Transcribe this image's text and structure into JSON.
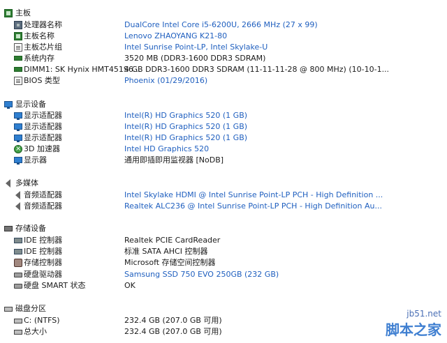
{
  "sections": {
    "motherboard": {
      "title": "主板",
      "items": [
        {
          "label": "处理器名称",
          "value": "DualCore Intel Core i5-6200U, 2666 MHz (27 x 99)",
          "icon": "cpu-icon"
        },
        {
          "label": "主板名称",
          "value": "Lenovo ZHAOYANG K21-80",
          "icon": "motherboard-icon"
        },
        {
          "label": "主板芯片组",
          "value": "Intel Sunrise Point-LP, Intel Skylake-U",
          "icon": "chipset-icon"
        },
        {
          "label": "系统内存",
          "value": "3520 MB  (DDR3-1600 DDR3 SDRAM)",
          "icon": "memory-icon"
        },
        {
          "label": "DIMM1: SK Hynix HMT451S6...",
          "value": "4 GB DDR3-1600 DDR3 SDRAM  (11-11-11-28 @ 800 MHz)  (10-10-1...",
          "icon": "memory-icon"
        },
        {
          "label": "BIOS 类型",
          "value": "Phoenix (01/29/2016)",
          "icon": "bios-icon"
        }
      ]
    },
    "display": {
      "title": "显示设备",
      "items": [
        {
          "label": "显示适配器",
          "value": "Intel(R) HD Graphics 520  (1 GB)",
          "icon": "display-adapter-icon"
        },
        {
          "label": "显示适配器",
          "value": "Intel(R) HD Graphics 520  (1 GB)",
          "icon": "display-adapter-icon"
        },
        {
          "label": "显示适配器",
          "value": "Intel(R) HD Graphics 520  (1 GB)",
          "icon": "display-adapter-icon"
        },
        {
          "label": "3D 加速器",
          "value": "Intel HD Graphics 520",
          "icon": "3d-accelerator-icon"
        },
        {
          "label": "显示器",
          "value": "通用即插即用监视器 [NoDB]",
          "icon": "monitor-icon"
        }
      ]
    },
    "multimedia": {
      "title": "多媒体",
      "items": [
        {
          "label": "音频适配器",
          "value": "Intel Skylake HDMI @ Intel Sunrise Point-LP PCH - High Definition ...",
          "icon": "speaker-icon"
        },
        {
          "label": "音频适配器",
          "value": "Realtek ALC236 @ Intel Sunrise Point-LP PCH - High Definition Au...",
          "icon": "speaker-icon"
        }
      ]
    },
    "storage": {
      "title": "存储设备",
      "items": [
        {
          "label": "IDE 控制器",
          "value": "Realtek PCIE CardReader",
          "icon": "ide-controller-icon"
        },
        {
          "label": "IDE 控制器",
          "value": "标准 SATA AHCI 控制器",
          "icon": "ide-controller-icon"
        },
        {
          "label": "存储控制器",
          "value": "Microsoft 存储空间控制器",
          "icon": "storage-controller-icon"
        },
        {
          "label": "硬盘驱动器",
          "value": "Samsung SSD 750 EVO 250GB  (232 GB)",
          "icon": "hard-drive-icon"
        },
        {
          "label": "硬盘 SMART 状态",
          "value": "OK",
          "icon": "hard-drive-icon"
        }
      ]
    },
    "partitions": {
      "title": "磁盘分区",
      "items": [
        {
          "label": "C: (NTFS)",
          "value": "232.4 GB (207.0 GB 可用)",
          "icon": "partition-icon"
        },
        {
          "label": "总大小",
          "value": "232.4 GB (207.0 GB 可用)",
          "icon": "partition-icon"
        }
      ]
    }
  },
  "watermark": {
    "site": "jb51.net",
    "brand": "脚本之家"
  },
  "colors": {
    "link": "#1f5fbf",
    "text": "#1a1a1a",
    "background": "#ffffff"
  }
}
